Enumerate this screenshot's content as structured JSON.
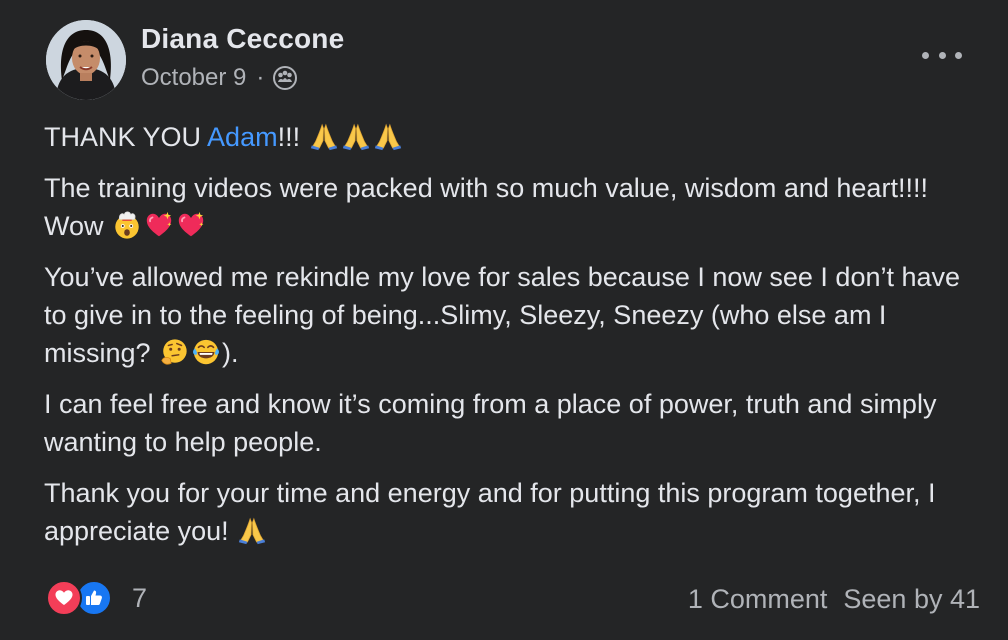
{
  "post": {
    "author": "Diana Ceccone",
    "date": "October 9",
    "separator": "·",
    "privacy_icon": "friends-icon",
    "paragraphs": {
      "p1_before": "THANK YOU ",
      "p1_mention": "Adam",
      "p1_after": "!!! ",
      "p2_text": "The training videos were packed with so much value, wisdom and heart!!!! Wow ",
      "p3_text": "You’ve allowed me rekindle my love for sales because I now see I don’t have to give in to the feeling of being...Slimy, Sleezy, Sneezy (who else am I missing? ",
      "p3_end": ").",
      "p4_text": "I can feel free and know it’s coming from a place of power, truth and simply wanting to help people.",
      "p5_text": "Thank you for your time and energy and for putting this program together, I appreciate you! "
    }
  },
  "footer": {
    "reaction_icons": [
      "love-icon",
      "like-icon"
    ],
    "reaction_count": "7",
    "comments": "1 Comment",
    "seen_by": "Seen by 41"
  },
  "colors": {
    "background": "#242526",
    "text": "#e4e6eb",
    "secondary_text": "#b0b3b8",
    "mention": "#4599ff",
    "love": "#f33e58",
    "like": "#1877f2"
  }
}
